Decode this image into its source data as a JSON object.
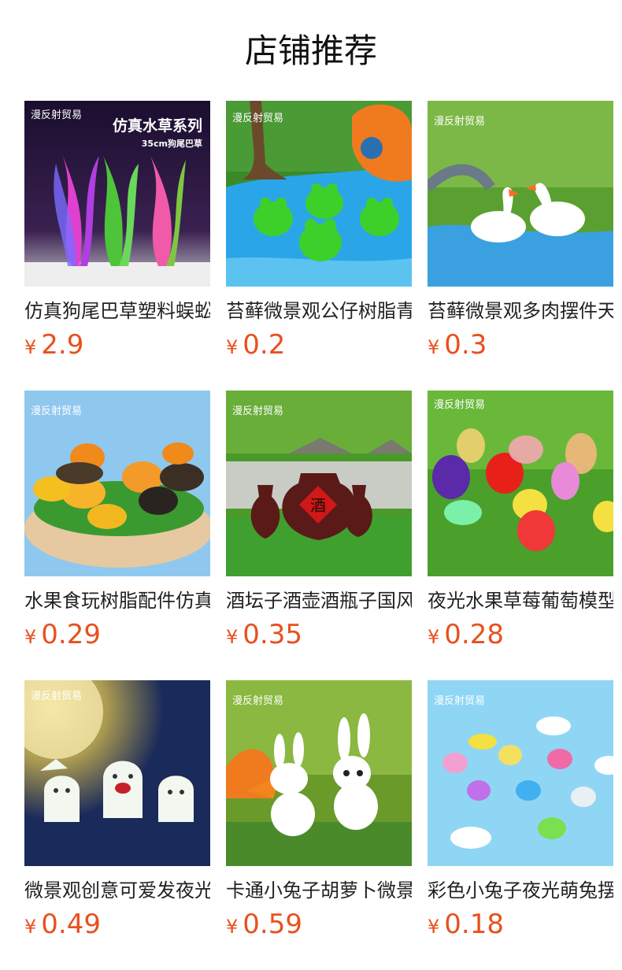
{
  "header": {
    "title": "店铺推荐"
  },
  "products": [
    {
      "name": "仿真狗尾巴草塑料蜈蚣草鱼缸造景装饰水族箱",
      "currency": "¥",
      "price": "2.9",
      "badge_brand": "漫反射贸易",
      "badge_title": "仿真水草系列",
      "badge_sub": "35cm狗尾巴草"
    },
    {
      "name": "苔藓微景观公仔树脂青蛙摆件",
      "currency": "¥",
      "price": "0.2",
      "badge_brand": "漫反射贸易"
    },
    {
      "name": "苔藓微景观多肉摆件天鹅",
      "currency": "¥",
      "price": "0.3",
      "badge_brand": "漫反射贸易"
    },
    {
      "name": "水果食玩树脂配件仿真南瓜",
      "currency": "¥",
      "price": "0.29",
      "badge_brand": "漫反射贸易"
    },
    {
      "name": "酒坛子酒壶酒瓶子国风微景观",
      "currency": "¥",
      "price": "0.35",
      "badge_brand": "漫反射贸易",
      "jar_label": "酒"
    },
    {
      "name": "夜光水果草莓葡萄模型摆件",
      "currency": "¥",
      "price": "0.28",
      "badge_brand": "漫反射贸易"
    },
    {
      "name": "微景观创意可爱发夜光幽灵摆件",
      "currency": "¥",
      "price": "0.49",
      "badge_brand": "漫反射贸易"
    },
    {
      "name": "卡通小兔子胡萝卜微景观摆件",
      "currency": "¥",
      "price": "0.59",
      "badge_brand": "漫反射贸易"
    },
    {
      "name": "彩色小兔子夜光萌兔摆件",
      "currency": "¥",
      "price": "0.18",
      "badge_brand": "漫反射贸易"
    }
  ]
}
